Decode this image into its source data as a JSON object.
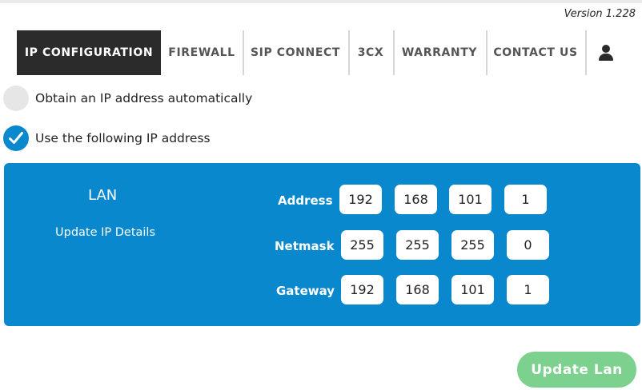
{
  "version": "Version 1.228",
  "nav": {
    "tabs": [
      {
        "label": "IP CONFIGURATION",
        "active": true
      },
      {
        "label": "FIREWALL",
        "active": false
      },
      {
        "label": "SIP CONNECT",
        "active": false
      },
      {
        "label": "3CX",
        "active": false
      },
      {
        "label": "WARRANTY",
        "active": false
      },
      {
        "label": "CONTACT US",
        "active": false
      }
    ],
    "user_icon": "user-icon"
  },
  "options": {
    "auto": {
      "label": "Obtain an IP address automatically",
      "selected": false
    },
    "manual": {
      "label": "Use the following IP address",
      "selected": true
    }
  },
  "lan": {
    "title": "LAN",
    "subtitle": "Update IP Details",
    "address": {
      "label": "Address",
      "octets": [
        "192",
        "168",
        "101",
        "1"
      ]
    },
    "netmask": {
      "label": "Netmask",
      "octets": [
        "255",
        "255",
        "255",
        "0"
      ]
    },
    "gateway": {
      "label": "Gateway",
      "octets": [
        "192",
        "168",
        "101",
        "1"
      ]
    }
  },
  "update_button": "Update Lan",
  "colors": {
    "panel": "#0a88ce",
    "active_tab": "#2b2b2b",
    "button": "#7dd18f"
  }
}
